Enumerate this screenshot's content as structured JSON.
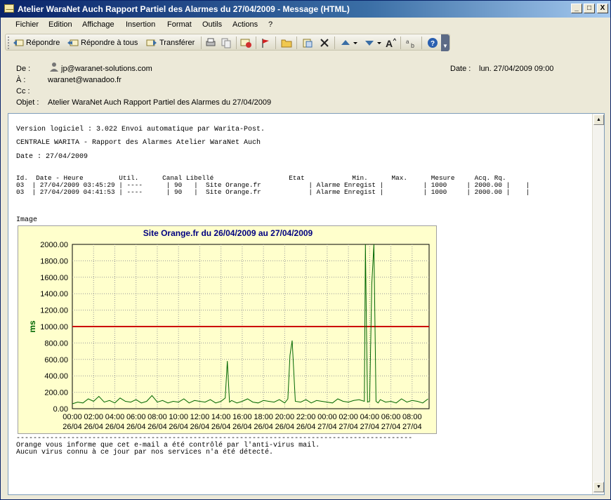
{
  "window": {
    "title": "Atelier WaraNet Auch Rapport Partiel des Alarmes du 27/04/2009 - Message (HTML)",
    "buttons": [
      "_",
      "□",
      "X"
    ]
  },
  "menu": [
    "Fichier",
    "Edition",
    "Affichage",
    "Insertion",
    "Format",
    "Outils",
    "Actions",
    "?"
  ],
  "toolbar": {
    "reply": "Répondre",
    "reply_all": "Répondre à tous",
    "forward": "Transférer"
  },
  "header": {
    "from_label": "De :",
    "from": "jp@waranet-solutions.com",
    "to_label": "À :",
    "to": "waranet@wanadoo.fr",
    "cc_label": "Cc :",
    "cc": "",
    "subject_label": "Objet :",
    "subject": "Atelier WaraNet Auch Rapport Partiel des Alarmes du 27/04/2009",
    "date_label": "Date :",
    "date": "lun. 27/04/2009 09:00"
  },
  "body": {
    "line1": "Version logiciel : 3.022 Envoi automatique par Warita-Post.",
    "line2": "CENTRALE WARITA - Rapport des Alarmes Atelier WaraNet Auch",
    "line3": "Date : 27/04/2009",
    "table_header": "Id.  Date - Heure         Util.      Canal Libellé                   Etat            Min.      Max.      Mesure     Acq. Rq.",
    "table_rows": [
      "03  | 27/04/2009 03:45:29 | ----      | 90   |  Site Orange.fr            | Alarme Enregist |          | 1000     | 2000.00 |    |",
      "03  | 27/04/2009 04:41:53 | ----      | 90   |  Site Orange.fr            | Alarme Enregist |          | 1000     | 2000.00 |    |"
    ],
    "image_label": "Image",
    "divider": "----------------------------------------------------------------------------------------------",
    "footer1": "Orange vous informe que cet e-mail a été contrôlé par l'anti-virus mail.",
    "footer2": "Aucun virus connu à ce jour par nos services n'a été détecté."
  },
  "colors": {
    "threshold": "#cc0000",
    "series": "#006600",
    "plot_bg": "#ffffcc",
    "title": "#000080"
  },
  "chart_data": {
    "type": "line",
    "title": "Site Orange.fr du 26/04/2009 au 27/04/2009",
    "ylabel": "ms",
    "xlabel": "",
    "ylim": [
      0,
      2000
    ],
    "yticks": [
      "0.00",
      "200.00",
      "400.00",
      "600.00",
      "800.00",
      "1000.00",
      "1200.00",
      "1400.00",
      "1600.00",
      "1800.00",
      "2000.00"
    ],
    "xticks": [
      {
        "time": "00:00",
        "day": "26/04"
      },
      {
        "time": "02:00",
        "day": "26/04"
      },
      {
        "time": "04:00",
        "day": "26/04"
      },
      {
        "time": "06:00",
        "day": "26/04"
      },
      {
        "time": "08:00",
        "day": "26/04"
      },
      {
        "time": "10:00",
        "day": "26/04"
      },
      {
        "time": "12:00",
        "day": "26/04"
      },
      {
        "time": "14:00",
        "day": "26/04"
      },
      {
        "time": "16:00",
        "day": "26/04"
      },
      {
        "time": "18:00",
        "day": "26/04"
      },
      {
        "time": "20:00",
        "day": "26/04"
      },
      {
        "time": "22:00",
        "day": "26/04"
      },
      {
        "time": "00:00",
        "day": "27/04"
      },
      {
        "time": "02:00",
        "day": "27/04"
      },
      {
        "time": "04:00",
        "day": "27/04"
      },
      {
        "time": "06:00",
        "day": "27/04"
      },
      {
        "time": "08:00",
        "day": "27/04"
      }
    ],
    "grid": true,
    "threshold": 1000,
    "series": [
      {
        "hours": [
          0,
          0.5,
          1,
          1.5,
          2,
          2.5,
          3,
          3.5,
          4,
          4.5,
          5,
          5.5,
          6,
          6.5,
          7,
          7.5,
          8,
          8.5,
          9,
          9.5,
          10,
          10.5,
          11,
          11.5,
          12,
          12.5,
          13,
          13.5,
          14,
          14.4,
          14.6,
          14.8,
          15,
          15.5,
          16,
          16.5,
          17,
          17.5,
          18,
          18.5,
          19,
          19.5,
          20,
          20.3,
          20.5,
          20.7,
          21,
          21.5,
          22,
          22.5,
          23,
          23.5,
          24,
          24.5,
          25,
          25.5,
          26,
          26.5,
          27,
          27.5,
          27.6,
          27.7,
          27.8,
          28,
          28.2,
          28.4,
          28.6,
          28.8,
          29,
          29.5,
          30,
          30.5,
          31,
          31.5,
          32,
          32.5,
          33,
          33.5
        ],
        "values": [
          60,
          80,
          70,
          120,
          90,
          150,
          80,
          100,
          70,
          130,
          90,
          80,
          110,
          70,
          90,
          160,
          80,
          100,
          70,
          90,
          80,
          120,
          70,
          100,
          90,
          80,
          110,
          70,
          90,
          130,
          580,
          80,
          100,
          70,
          90,
          120,
          80,
          70,
          100,
          90,
          80,
          110,
          70,
          120,
          650,
          830,
          90,
          80,
          110,
          70,
          100,
          90,
          80,
          70,
          120,
          90,
          80,
          100,
          110,
          90,
          2000,
          1000,
          80,
          90,
          1520,
          2000,
          90,
          70,
          110,
          80,
          90,
          70,
          120,
          80,
          100,
          90,
          70,
          120
        ]
      }
    ]
  }
}
